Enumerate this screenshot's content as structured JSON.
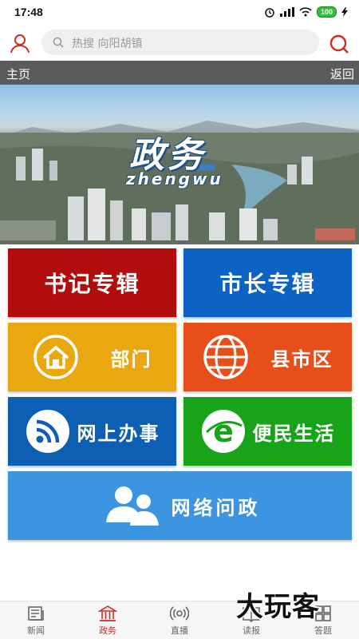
{
  "status_bar": {
    "time": "17:48",
    "battery": "100"
  },
  "search": {
    "placeholder": "热搜  向阳胡镇"
  },
  "nav": {
    "home": "主页",
    "back": "返回"
  },
  "banner": {
    "title": "政务",
    "subtitle": "zhengwu"
  },
  "tiles": {
    "secretary": "书记专辑",
    "mayor": "市长专辑",
    "department": "部门",
    "county": "县市区",
    "online_services": "网上办事",
    "public_services": "便民生活",
    "online_politics": "网络问政"
  },
  "tabs": [
    {
      "label": "新闻",
      "icon": "newspaper-icon"
    },
    {
      "label": "政务",
      "icon": "government-building-icon"
    },
    {
      "label": "直播",
      "icon": "broadcast-icon"
    },
    {
      "label": "读报",
      "icon": "read-paper-icon"
    },
    {
      "label": "答题",
      "icon": "quiz-icon"
    }
  ],
  "active_tab": "政务",
  "watermark": "大玩客",
  "colors": {
    "accent": "#d12b1f",
    "tile_secretary": "#b10d0d",
    "tile_mayor": "#0d63c4",
    "tile_department": "#e9a80f",
    "tile_county": "#e64e1a",
    "tile_online_services": "#0d5fb3",
    "tile_public_services": "#19a319",
    "tile_online_politics": "#3b95e1"
  }
}
